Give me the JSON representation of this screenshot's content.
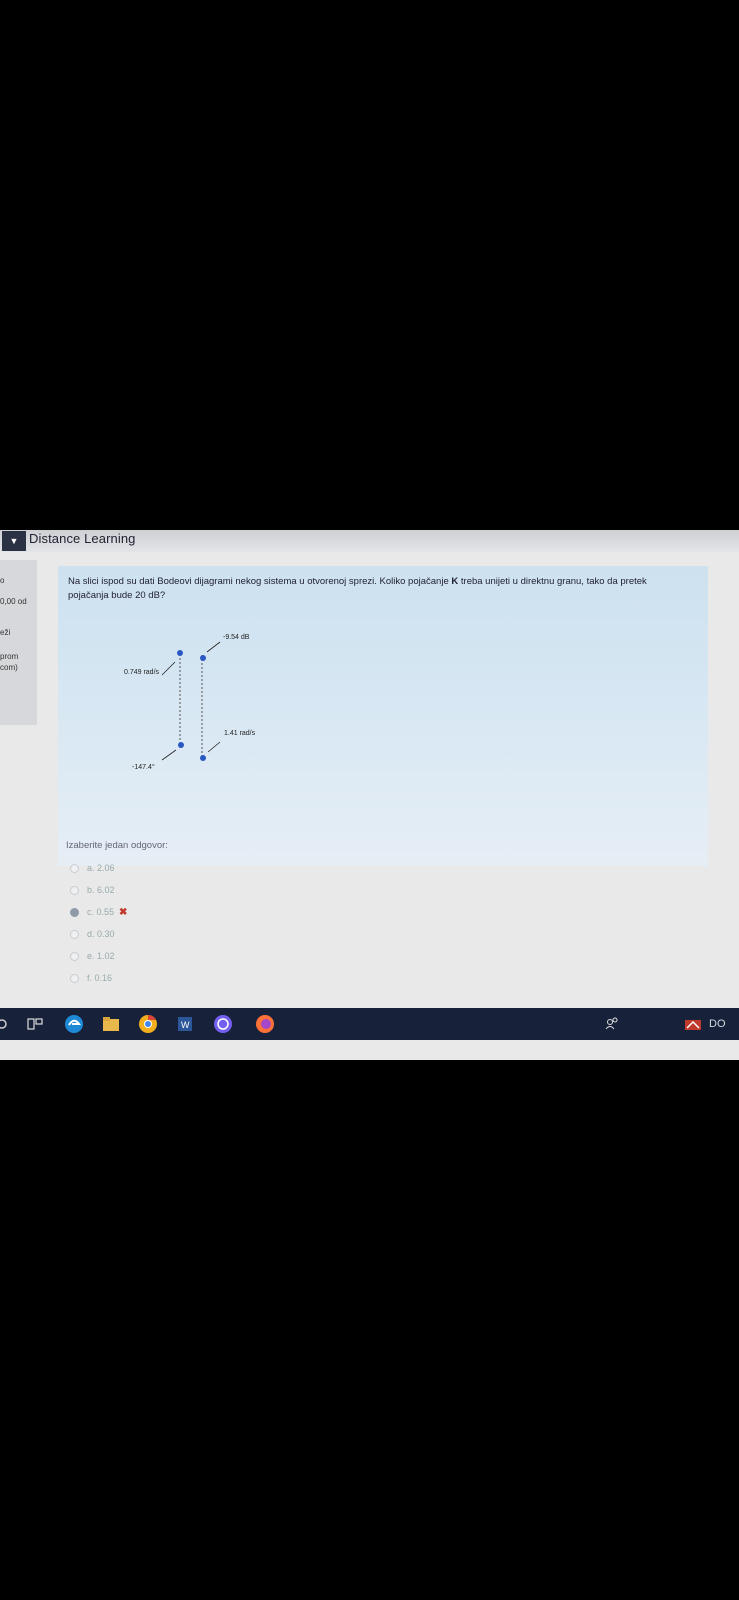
{
  "app": {
    "title": "Distance Learning",
    "logo": "logo-icon"
  },
  "sidebar": {
    "items": [
      "o",
      "0,00 od",
      "eži",
      "prom",
      "com)"
    ]
  },
  "question": {
    "text_before": "Na slici ispod su dati Bodeovi dijagrami nekog sistema u otvorenoj sprezi. Koliko pojačanje ",
    "bold": "K",
    "text_after": " treba unijeti u direktnu granu, tako da pretek pojačanja bude 20 dB?"
  },
  "diagram": {
    "labels": {
      "gain_db": "-9.54 dB",
      "crossover_freq": "0.749 rad/s",
      "phase_freq": "1.41 rad/s",
      "phase_deg": "-147.4°"
    }
  },
  "answers": {
    "prompt": "Izaberite jedan odgovor:",
    "options": [
      {
        "label": "a. 2.06",
        "selected": false
      },
      {
        "label": "b. 6.02",
        "selected": false
      },
      {
        "label": "c. 0.55",
        "selected": true,
        "wrong_mark": "✖"
      },
      {
        "label": "d. 0.30",
        "selected": false
      },
      {
        "label": "e. 1.02",
        "selected": false
      },
      {
        "label": "f. 0.16",
        "selected": false
      }
    ]
  },
  "taskbar": {
    "icons": [
      "search-icon",
      "task-view-icon",
      "edge-icon",
      "file-explorer-icon",
      "chrome-icon",
      "word-icon",
      "viber-icon",
      "firefox-icon"
    ],
    "tray_text": "DO",
    "people_icon": "people-icon"
  },
  "colors": {
    "taskbar": "#17213a",
    "content": "#cde1ef",
    "accent": "#2b59c3",
    "wrong": "#c0392b"
  }
}
